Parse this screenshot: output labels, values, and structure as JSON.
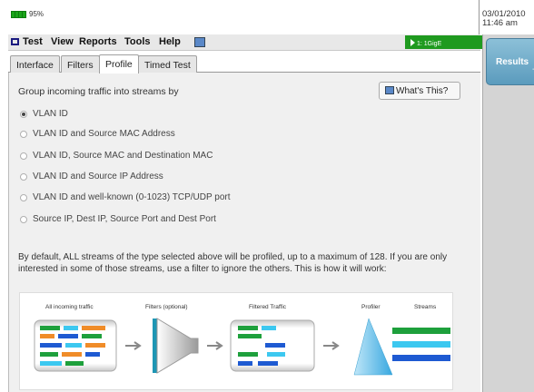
{
  "status": {
    "battery_pct": "95%",
    "date": "03/01/2010",
    "time": "11:46 am"
  },
  "menu": {
    "test": "Test",
    "view": "View",
    "reports": "Reports",
    "tools": "Tools",
    "help": "Help",
    "port_status": "1: 1GigE"
  },
  "side": {
    "results_label": "Results"
  },
  "tabs": [
    {
      "label": "Interface",
      "active": false
    },
    {
      "label": "Filters",
      "active": false
    },
    {
      "label": "Profile",
      "active": true
    },
    {
      "label": "Timed Test",
      "active": false
    }
  ],
  "profile": {
    "prompt": "Group incoming traffic into streams by",
    "whats_this": "What's This?",
    "options": [
      {
        "label": "VLAN ID",
        "selected": true
      },
      {
        "label": "VLAN ID and Source MAC Address",
        "selected": false
      },
      {
        "label": "VLAN ID, Source MAC and Destination MAC",
        "selected": false
      },
      {
        "label": "VLAN ID and Source IP Address",
        "selected": false
      },
      {
        "label": "VLAN ID and well-known (0-1023) TCP/UDP port",
        "selected": false
      },
      {
        "label": "Source IP, Dest IP, Source Port and Dest Port",
        "selected": false
      }
    ],
    "description": "By default, ALL streams of the type selected above will be profiled, up to a maximum of 128. If you are only interested in some of those streams, use a filter to ignore the others. This is how it will work:"
  },
  "diagram": {
    "labels": {
      "incoming": "All incoming traffic",
      "filters": "Filters (optional)",
      "filtered": "Filtered Traffic",
      "profiler": "Profiler",
      "streams": "Streams"
    },
    "colors": {
      "green": "#1ea03c",
      "orange": "#f08c28",
      "cyan": "#3cc8f0",
      "blue": "#1e5ad2",
      "teal": "#1e96b4",
      "profiler": "#4fb8e8"
    }
  }
}
